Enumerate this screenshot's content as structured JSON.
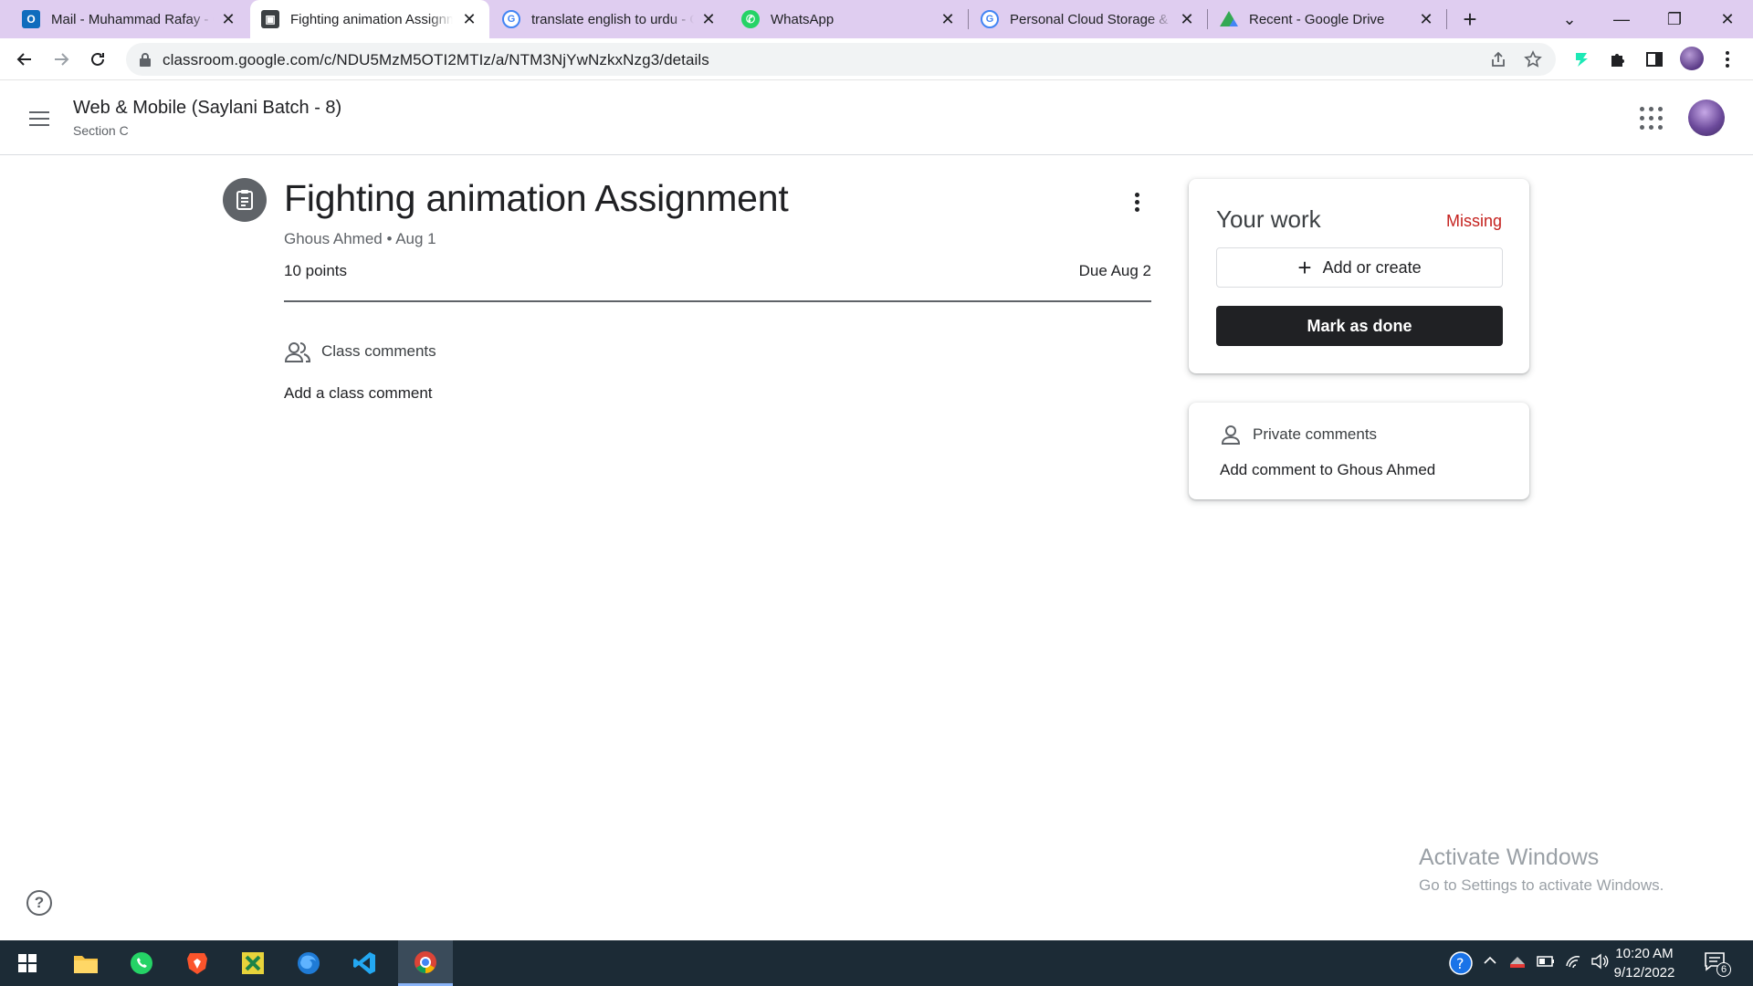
{
  "browser": {
    "tabs": [
      {
        "title": "Mail - Muhammad Rafay - Outlook",
        "favicon": "outlook-icon",
        "color": "#0f6cbd"
      },
      {
        "title": "Fighting animation Assignment",
        "favicon": "classroom-icon",
        "color": "#3c4043"
      },
      {
        "title": "translate english to urdu - Google Search",
        "favicon": "google-icon",
        "color": "#4285f4"
      },
      {
        "title": "WhatsApp",
        "favicon": "whatsapp-icon",
        "color": "#25d366"
      },
      {
        "title": "Personal Cloud Storage & File Sharing",
        "favicon": "google-icon",
        "color": "#4285f4"
      },
      {
        "title": "Recent - Google Drive",
        "favicon": "google-drive-icon",
        "color": "#34a853"
      }
    ],
    "active_tab": 1,
    "url": "classroom.google.com/c/NDU5MzM5OTI2MTIz/a/NTM3NjYwNzkxNzg3/details"
  },
  "header": {
    "class_title": "Web & Mobile (Saylani Batch - 8)",
    "section": "Section C"
  },
  "assignment": {
    "title": "Fighting animation Assignment",
    "meta": "Ghous Ahmed • Aug 1",
    "points": "10 points",
    "due": "Due Aug 2",
    "class_comments_label": "Class comments",
    "add_class_comment": "Add a class comment"
  },
  "your_work": {
    "title": "Your work",
    "status": "Missing",
    "status_color": "#c5221f",
    "add_create_label": "Add or create",
    "mark_done_label": "Mark as done"
  },
  "private_comments": {
    "label": "Private comments",
    "add_label": "Add comment to Ghous Ahmed"
  },
  "help_label": "?",
  "watermark": {
    "line1": "Activate Windows",
    "line2": "Go to Settings to activate Windows."
  },
  "taskbar": {
    "apps": [
      "windows-start-icon",
      "file-explorer-icon",
      "whatsapp-icon",
      "brave-icon",
      "excel-icon",
      "firefox-icon",
      "vscode-icon",
      "chrome-icon"
    ],
    "time": "10:20 AM",
    "date": "9/12/2022",
    "notification_count": "6"
  }
}
